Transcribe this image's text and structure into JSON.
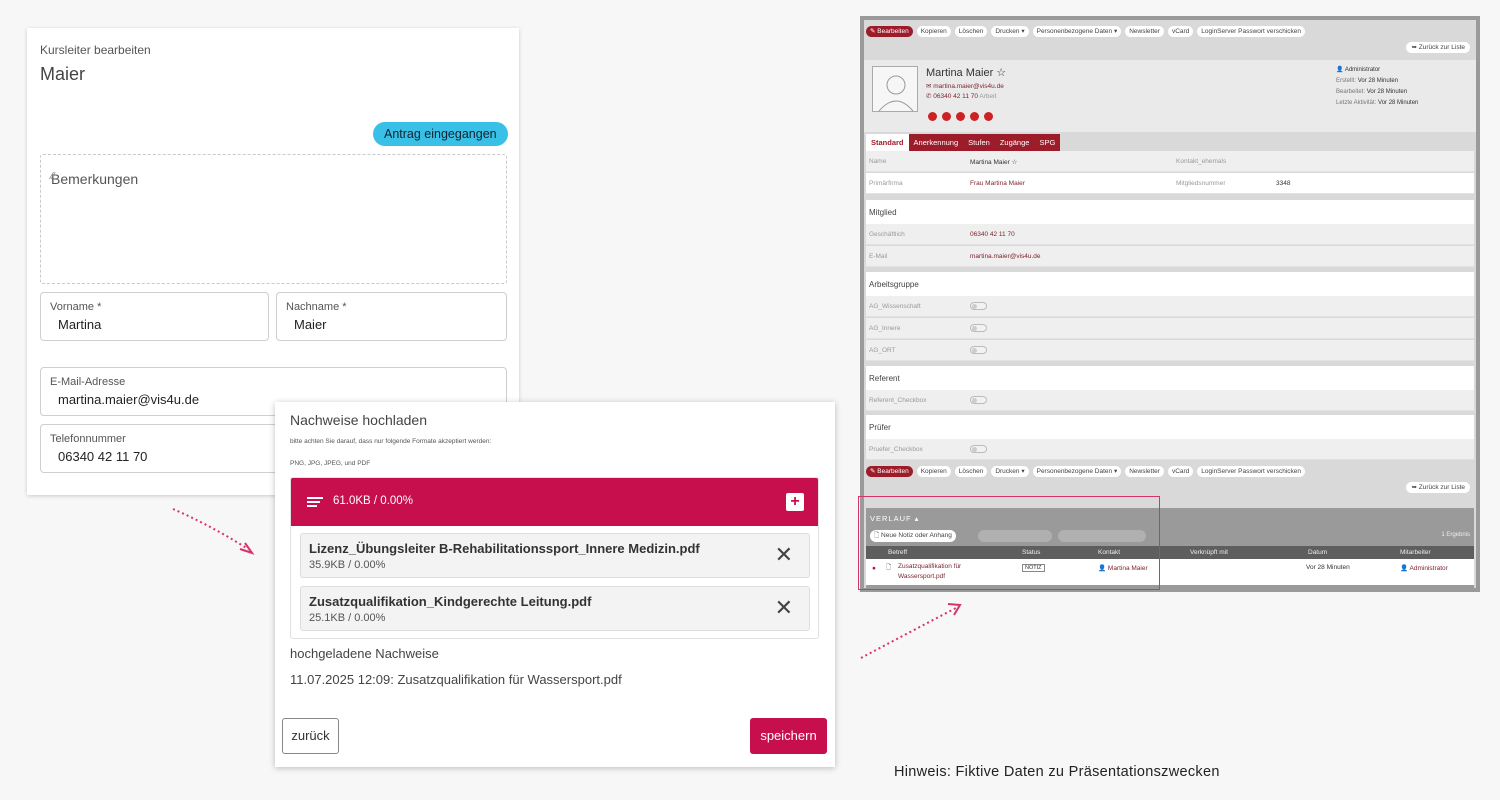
{
  "form": {
    "subtitle": "Kursleiter bearbeiten",
    "name": "Maier",
    "status_badge": "Antrag eingegangen",
    "remarks_placeholder": "Bemerkungen",
    "firstname_label": "Vorname *",
    "firstname_value": "Martina",
    "lastname_label": "Nachname *",
    "lastname_value": "Maier",
    "email_label": "E-Mail-Adresse",
    "email_value": "martina.maier@vis4u.de",
    "phone_label": "Telefonnummer",
    "phone_value": "06340 42 11 70"
  },
  "upload": {
    "title": "Nachweise hochladen",
    "hint": "bitte achten Sie darauf, dass nur folgende Formate akzeptiert werden:",
    "formats": "PNG, JPG, JPEG, und PDF",
    "total": "61.0KB / 0.00%",
    "files": [
      {
        "name": "Lizenz_Übungsleiter B-Rehabilitationssport_Innere Medizin.pdf",
        "size": "35.9KB / 0.00%"
      },
      {
        "name": "Zusatzqualifikation_Kindgerechte Leitung.pdf",
        "size": "25.1KB / 0.00%"
      }
    ],
    "uploaded_heading": "hochgeladene Nachweise",
    "uploaded_entry": "11.07.2025 12:09:  Zusatzqualifikation für Wassersport.pdf",
    "back_label": "zurück",
    "save_label": "speichern"
  },
  "crm": {
    "toolbar": [
      "Bearbeiten",
      "Kopieren",
      "Löschen",
      "Drucken ▾",
      "Personenbezogene Daten ▾",
      "Newsletter",
      "vCard",
      "LoginServer Passwort verschicken"
    ],
    "back_to_list": "Zurück zur Liste",
    "profile_name": "Martina Maier ☆",
    "profile_email": "martina.maier@vis4u.de",
    "profile_phone": "06340 42 11 70",
    "profile_phone_type": "Arbeit",
    "meta_owner": "Administrator",
    "meta_created_label": "Erstellt:",
    "meta_created": "Vor 28 Minuten",
    "meta_edited_label": "Bearbeitet:",
    "meta_edited": "Vor 28 Minuten",
    "meta_last_label": "Letzte Aktivität:",
    "meta_last": "Vor 28 Minuten",
    "tabs": [
      "Standard",
      "Anerkennung",
      "Stufen",
      "Zugänge",
      "SPG"
    ],
    "name_label": "Name",
    "name_value": "Martina Maier ☆",
    "kontakt_label": "Kontakt_ehemals",
    "primaerfirma_label": "Primärfirma",
    "primaerfirma_value": "Frau Martina Maier",
    "mitgliedsnummer_label": "Mitgliedsnummer",
    "mitgliedsnummer_value": "3348",
    "sect_mitglied": "Mitglied",
    "geschaeftlich_label": "Geschäftlich",
    "geschaeftlich_value": "06340 42 11 70",
    "email_label": "E-Mail",
    "email_value": "martina.maier@vis4u.de",
    "sect_arbeitsgruppe": "Arbeitsgruppe",
    "ag1": "AG_Wissenschaft",
    "ag2": "AG_Innere",
    "ag3": "AG_ORT",
    "sect_referent": "Referent",
    "referent_cb": "Referent_Checkbox",
    "sect_pruefer": "Prüfer",
    "pruefer_cb": "Pruefer_Checkbox",
    "verlauf_title": "VERLAUF ▴",
    "new_note": "Neue Notiz oder Anhang",
    "count": "1 Ergebnis",
    "cols": [
      "Betreff",
      "Status",
      "Kontakt",
      "Verknüpft mit",
      "Datum",
      "Mitarbeiter"
    ],
    "entry_subject_1": "Zusatzqualifikation für",
    "entry_subject_2": "Wassersport.pdf",
    "entry_status": "NOTIZ",
    "entry_contact": "Martina Maier",
    "entry_date": "Vor 28 Minuten",
    "entry_employee": "Administrator"
  },
  "footnote": "Hinweis: Fiktive Daten zu Präsentationszwecken",
  "colors": {
    "accent": "#c70f4d",
    "badge": "#39c0e6",
    "crm_red": "#9c1c2a",
    "highlight": "#d6336c"
  }
}
